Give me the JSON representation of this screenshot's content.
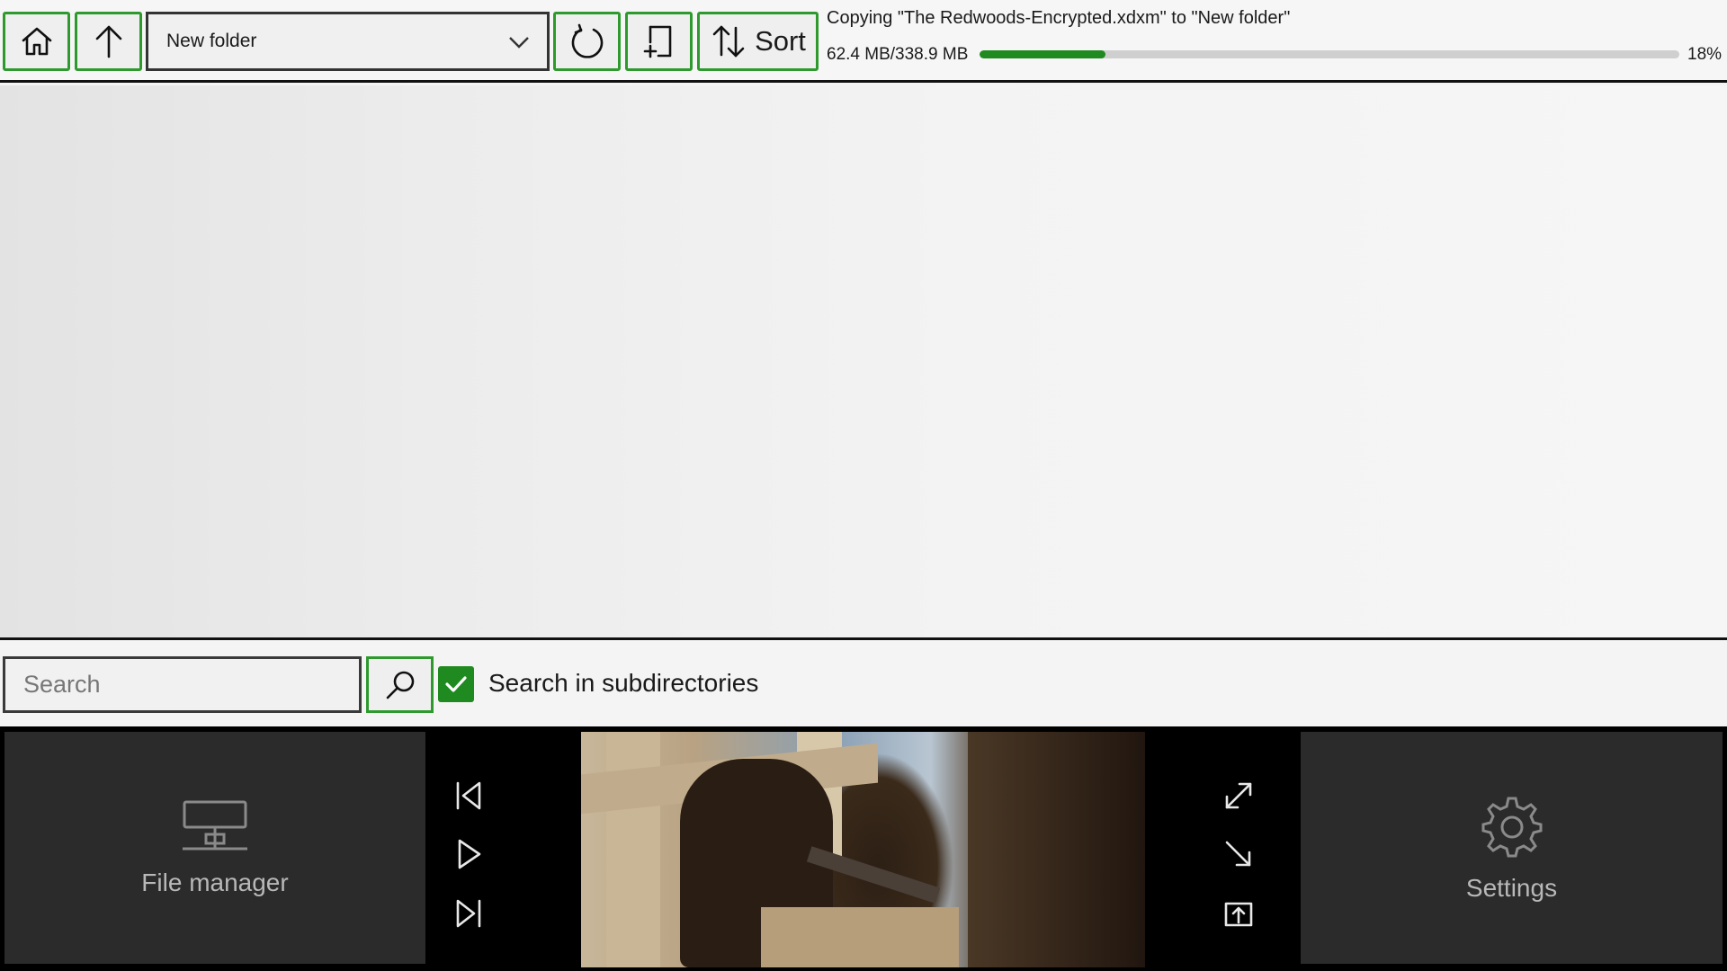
{
  "toolbar": {
    "path_value": "New folder",
    "sort_label": "Sort",
    "icons": {
      "home": "home-icon",
      "up": "arrow-up-icon",
      "refresh": "refresh-icon",
      "new_folder": "new-folder-icon",
      "sort": "sort-arrows-icon",
      "dropdown": "chevron-down-icon"
    }
  },
  "copy_status": {
    "title": "Copying \"The Redwoods-Encrypted.xdxm\" to \"New folder\"",
    "size": "62.4 MB/338.9 MB",
    "progress": 0.18,
    "percent_label": "18%"
  },
  "search": {
    "placeholder": "Search",
    "value": "",
    "subdirectories_label": "Search in subdirectories",
    "subdirectories_checked": true
  },
  "bottom_bar": {
    "file_manager_label": "File manager",
    "settings_label": "Settings",
    "media_controls": [
      "skip-previous-icon",
      "play-icon",
      "skip-next-icon"
    ],
    "window_controls": [
      "expand-icon",
      "shrink-icon",
      "share-out-icon"
    ]
  },
  "colors": {
    "accent": "#2e9a2e",
    "progress_fill": "#1f8a1f",
    "tile_bg": "#2b2b2b"
  }
}
